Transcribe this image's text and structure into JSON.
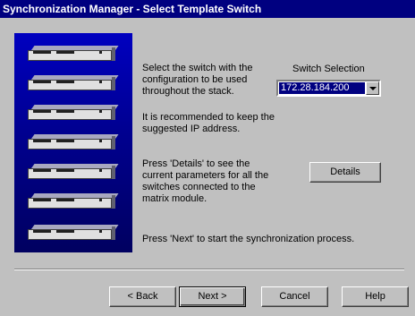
{
  "window": {
    "title": "Synchronization Manager - Select Template Switch"
  },
  "instructions": {
    "select_text": "Select the switch with the configuration to be used throughout the stack.",
    "recommend_text": "It is recommended to keep the suggested IP address.",
    "details_text": "Press 'Details' to see the current parameters for all the switches connected to the matrix module.",
    "next_text": "Press 'Next' to start the synchronization process."
  },
  "switch_selection": {
    "label": "Switch Selection",
    "value": "172.28.184.200"
  },
  "buttons": {
    "details": "Details",
    "back": "< Back",
    "next": "Next >",
    "cancel": "Cancel",
    "help": "Help"
  },
  "illustration": {
    "switch_count": 7
  }
}
